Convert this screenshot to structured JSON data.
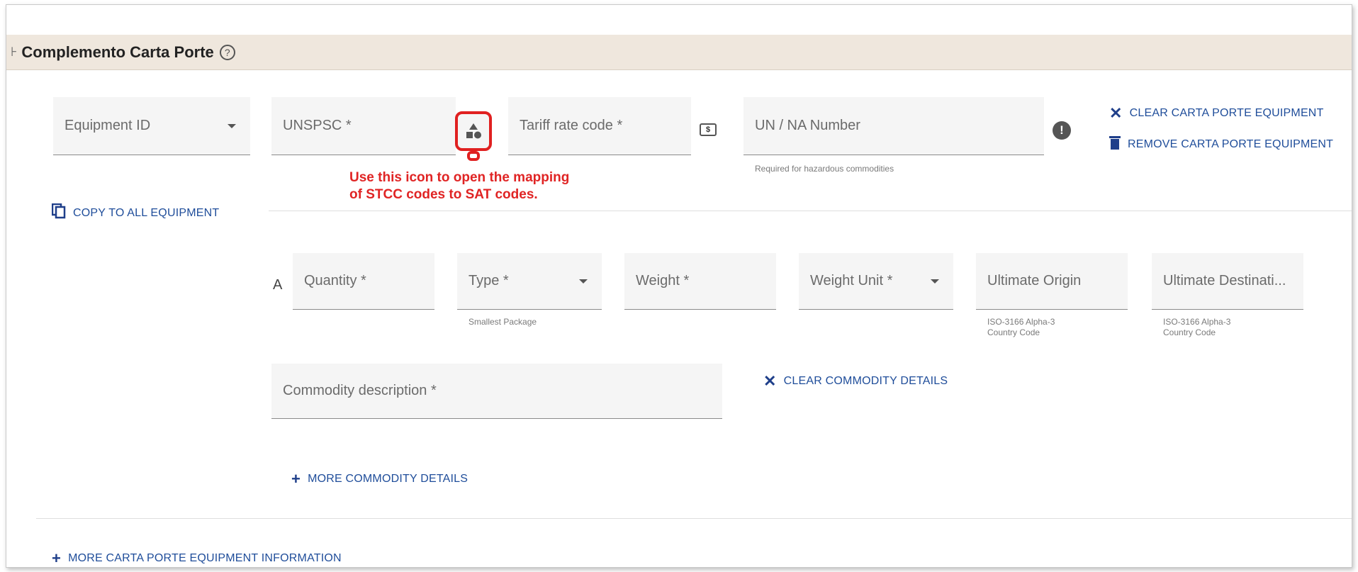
{
  "section": {
    "title": "Complemento Carta Porte",
    "collapse_icon": "⊦",
    "help_icon": "?"
  },
  "equipment": {
    "equipment_id_placeholder": "Equipment ID",
    "unspsc_placeholder": "UNSPSC *",
    "tariff_placeholder": "Tariff rate code *",
    "tariff_icon": "$",
    "un_na_placeholder": "UN / NA Number",
    "un_na_helper": "Required for hazardous commodities",
    "info_icon": "!",
    "clear_label": "CLEAR CARTA PORTE EQUIPMENT",
    "remove_label": "REMOVE CARTA PORTE EQUIPMENT",
    "copy_label": "COPY TO ALL EQUIPMENT",
    "more_label": "MORE CARTA PORTE EQUIPMENT INFORMATION"
  },
  "annotation": {
    "line1": "Use this icon to open the mapping",
    "line2": "of STCC codes to SAT codes."
  },
  "commodity": {
    "row_label": "A",
    "quantity_placeholder": "Quantity *",
    "type_placeholder": "Type *",
    "type_helper": "Smallest Package",
    "weight_placeholder": "Weight *",
    "weight_unit_placeholder": "Weight Unit *",
    "origin_placeholder": "Ultimate Origin",
    "origin_helper_1": "ISO-3166 Alpha-3",
    "origin_helper_2": "Country Code",
    "destination_placeholder": "Ultimate Destinati...",
    "destination_helper_1": "ISO-3166 Alpha-3",
    "destination_helper_2": "Country Code",
    "description_placeholder": "Commodity description *",
    "clear_label": "CLEAR COMMODITY DETAILS",
    "more_label": "MORE COMMODITY DETAILS"
  },
  "icons": {
    "clear": "close-icon",
    "remove": "trash-icon",
    "copy": "copy-icon",
    "add": "plus-icon",
    "mapping": "shapes-icon"
  },
  "colors": {
    "accent": "#1f4d9a",
    "annotation": "#e02424",
    "header_bg": "#efe7dd"
  }
}
